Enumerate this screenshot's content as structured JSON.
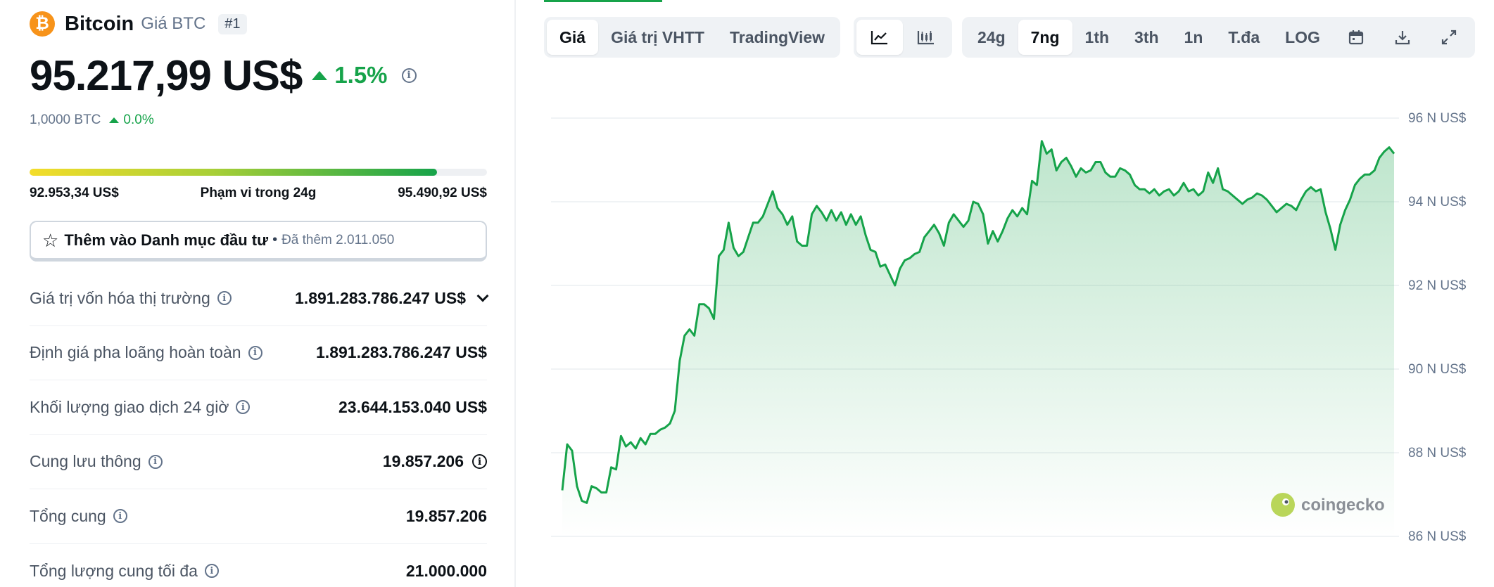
{
  "coin": {
    "logo_glyph": "₿",
    "name": "Bitcoin",
    "ticker_label": "Giá BTC",
    "rank": "#1",
    "price": "95.217,99 US$",
    "change_24h": "1.5%",
    "btc_amount": "1,0000 BTC",
    "btc_change": "0.0%",
    "accent_color": "#f7931a",
    "positive_color": "#16a34a"
  },
  "range_24h": {
    "low": "92.953,34 US$",
    "label": "Phạm vi trong 24g",
    "high": "95.490,92 US$",
    "position_fraction": 0.89
  },
  "watchlist": {
    "label": "Thêm vào Danh mục đầu tư",
    "separator": "•",
    "added_count": "Đã thêm 2.011.050"
  },
  "stats": [
    {
      "label": "Giá trị vốn hóa thị trường",
      "value": "1.891.283.786.247 US$",
      "expandable": true
    },
    {
      "label": "Định giá pha loãng hoàn toàn",
      "value": "1.891.283.786.247 US$"
    },
    {
      "label": "Khối lượng giao dịch 24 giờ",
      "value": "23.644.153.040 US$"
    },
    {
      "label": "Cung lưu thông",
      "value": "19.857.206",
      "value_info": true
    },
    {
      "label": "Tổng cung",
      "value": "19.857.206"
    },
    {
      "label": "Tổng lượng cung tối đa",
      "value": "21.000.000"
    }
  ],
  "chart_tabs": {
    "view": [
      "Giá",
      "Giá trị VHTT",
      "TradingView"
    ],
    "view_active": 0,
    "chart_type_icons": [
      "line-chart-icon",
      "candlestick-chart-icon"
    ],
    "chart_type_active": 0,
    "ranges": [
      "24g",
      "7ng",
      "1th",
      "3th",
      "1n",
      "T.đa",
      "LOG"
    ],
    "range_active": 1,
    "tool_icons": [
      "calendar-icon",
      "download-icon",
      "fullscreen-icon"
    ]
  },
  "watermark": "coingecko",
  "chart_data": {
    "type": "area",
    "y_ticks": [
      86000,
      88000,
      90000,
      92000,
      94000,
      96000
    ],
    "y_tick_labels": [
      "86 N US$",
      "88 N US$",
      "90 N US$",
      "92 N US$",
      "94 N US$",
      "96 N US$"
    ],
    "ylim": [
      86000,
      96000
    ],
    "grid": true,
    "line_color": "#16a34a",
    "series": [
      {
        "values": [
          87100,
          88200,
          88050,
          87200,
          86850,
          86800,
          87200,
          87150,
          87050,
          87050,
          87650,
          87600,
          88400,
          88150,
          88250,
          88100,
          88350,
          88200,
          88450,
          88450,
          88550,
          88600,
          88700,
          89000,
          90200,
          90800,
          90950,
          90800,
          91550,
          91550,
          91450,
          91200,
          92700,
          92850,
          93500,
          92900,
          92700,
          92800,
          93150,
          93500,
          93500,
          93650,
          93950,
          94250,
          93850,
          93700,
          93450,
          93650,
          93050,
          92950,
          92950,
          93700,
          93900,
          93750,
          93550,
          93800,
          93550,
          93750,
          93450,
          93700,
          93450,
          93650,
          93200,
          92850,
          92800,
          92450,
          92500,
          92250,
          92000,
          92400,
          92600,
          92650,
          92750,
          92800,
          93150,
          93300,
          93450,
          93250,
          92950,
          93500,
          93700,
          93550,
          93400,
          93550,
          94000,
          93950,
          93700,
          93000,
          93300,
          93050,
          93300,
          93600,
          93800,
          93650,
          93850,
          93700,
          94500,
          94400,
          95450,
          95150,
          95250,
          94750,
          94950,
          95050,
          94850,
          94600,
          94800,
          94700,
          94750,
          94950,
          94950,
          94700,
          94600,
          94600,
          94800,
          94750,
          94650,
          94400,
          94300,
          94300,
          94200,
          94300,
          94150,
          94250,
          94300,
          94150,
          94250,
          94450,
          94250,
          94300,
          94150,
          94250,
          94700,
          94450,
          94800,
          94300,
          94250,
          94150,
          94050,
          93950,
          94050,
          94100,
          94200,
          94150,
          94050,
          93900,
          93750,
          93850,
          93950,
          93900,
          93800,
          94050,
          94250,
          94350,
          94250,
          94300,
          93750,
          93350,
          92850,
          93450,
          93800,
          94050,
          94400,
          94550,
          94650,
          94650,
          94750,
          95050,
          95200,
          95300,
          95150
        ]
      }
    ]
  }
}
